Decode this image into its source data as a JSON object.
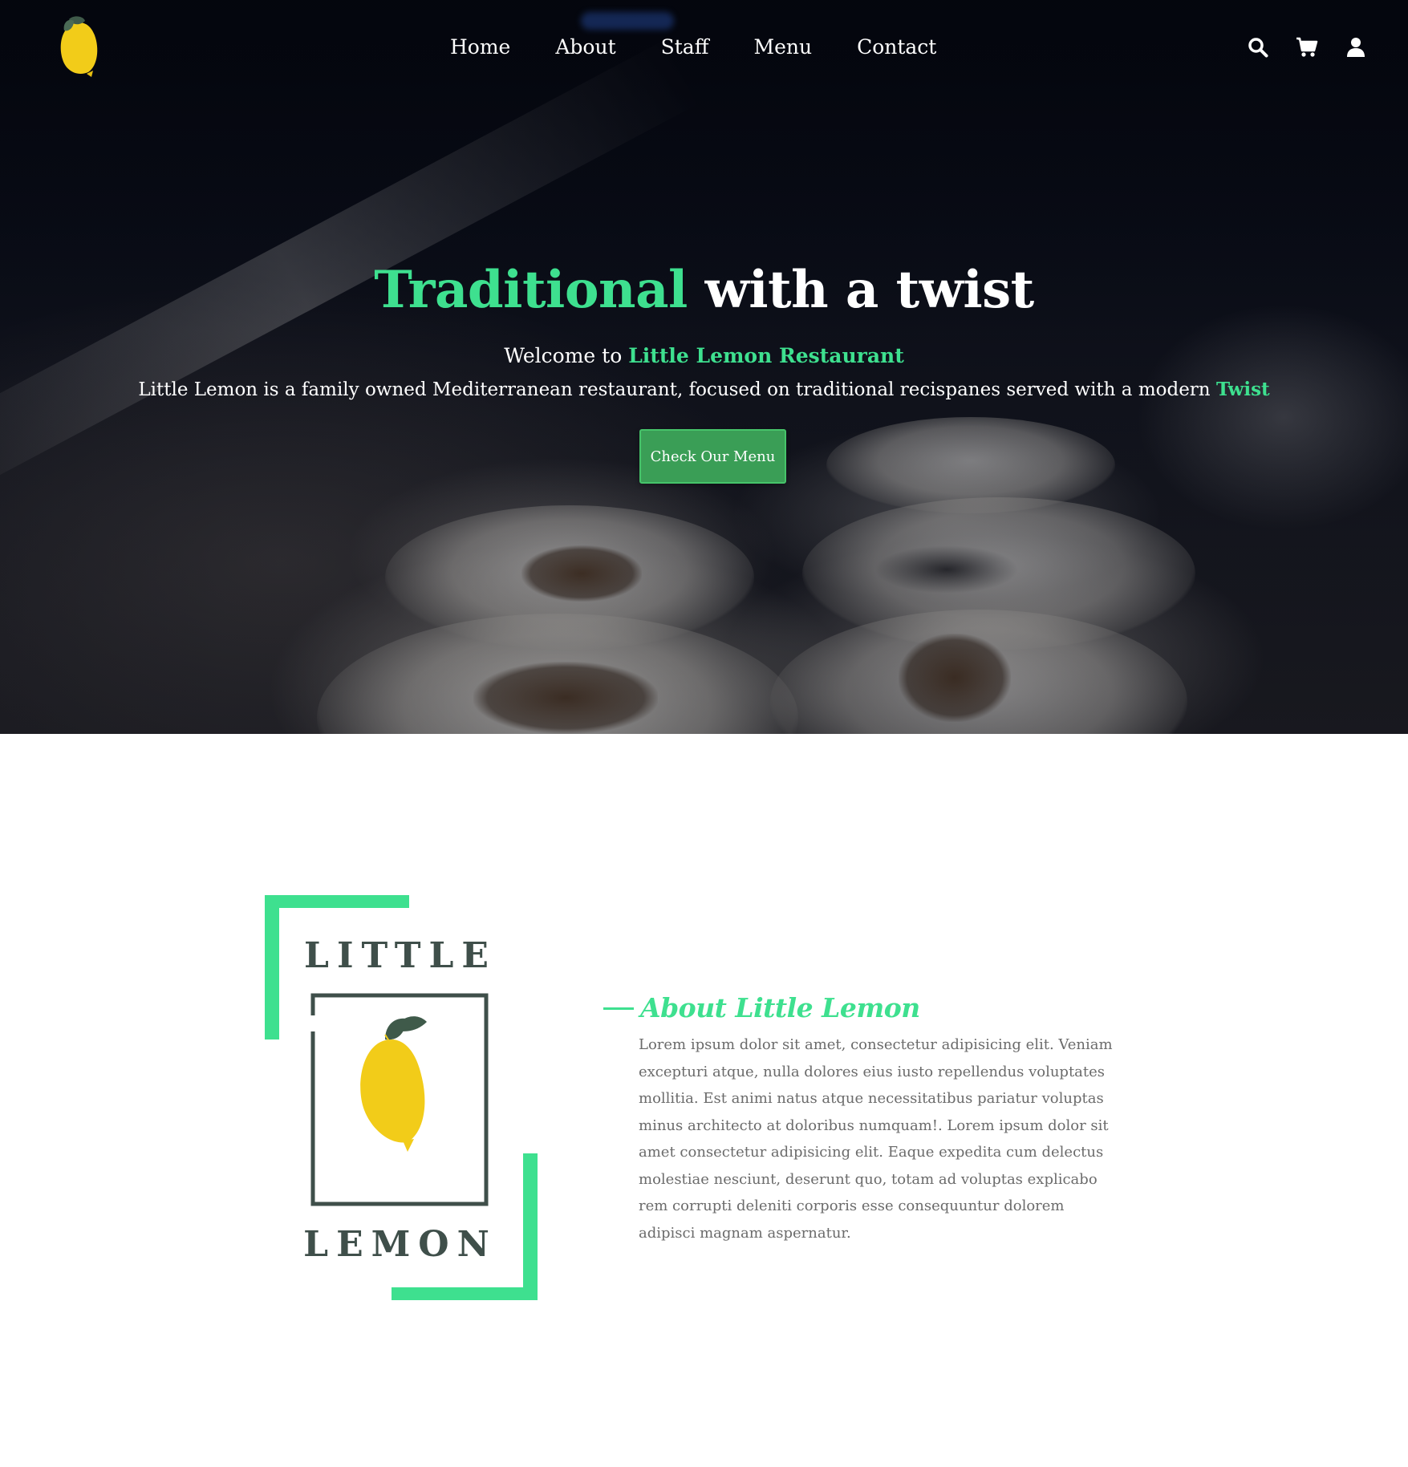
{
  "nav": {
    "logo_icon": "lemon-icon",
    "links": [
      {
        "label": "Home"
      },
      {
        "label": "About"
      },
      {
        "label": "Staff"
      },
      {
        "label": "Menu"
      },
      {
        "label": "Contact"
      }
    ],
    "icons": [
      "search-icon",
      "cart-icon",
      "user-icon"
    ]
  },
  "hero": {
    "title_accent": "Traditional",
    "title_rest": " with a twist",
    "welcome_prefix": "Welcome to ",
    "welcome_name": "Little Lemon Restaurant",
    "description": "Little Lemon is a family owned Mediterranean restaurant, focused on traditional recispanes served with a modern ",
    "description_accent": "Twist",
    "cta_label": "Check Our Menu"
  },
  "about": {
    "logo_top": "LITTLE",
    "logo_bottom": "LEMON",
    "heading": "About Little Lemon",
    "body": "Lorem ipsum dolor sit amet, consectetur adipisicing elit. Veniam excepturi atque, nulla dolores eius iusto repellendus voluptates mollitia. Est animi natus atque necessitatibus pariatur voluptas minus architecto at doloribus numquam!. Lorem ipsum dolor sit amet consectetur adipisicing elit. Eaque expedita cum delectus molestiae nesciunt, deserunt quo, totam ad voluptas explicabo rem corrupti deleniti corporis esse consequuntur dolorem adipisci magnam aspernatur."
  },
  "colors": {
    "accent": "#3ee08f",
    "button": "#3a9e56",
    "lemon": "#f2cc19",
    "logo_dark": "#3f4f4a"
  }
}
